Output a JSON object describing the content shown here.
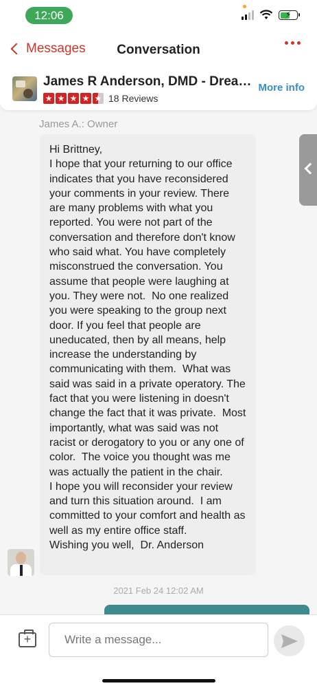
{
  "status_bar": {
    "time": "12:06",
    "signal_bars": 2,
    "battery_level": 0.6
  },
  "nav": {
    "back_label": "Messages",
    "title": "Conversation"
  },
  "business": {
    "name": "James R Anderson, DMD - Dreamw...",
    "rating": 4.5,
    "reviews_label": "18 Reviews",
    "more_info_label": "More info"
  },
  "conversation": {
    "sender_label": "James A.: Owner",
    "message": "Hi Brittney,\nI hope that your returning to our office indicates that you have reconsidered your comments in your review. There are many problems with what you reported. You were not part of the conversation and therefore don't know who said what. You have completely misconstrued the conversation. You assume that people were laughing at you. They were not.  No one realized you were speaking to the group next door. If you feel that people are uneducated, then by all means, help increase the understanding by communicating with them.  What was said was said in a private operatory. The fact that you were listening in doesn't change the fact that it was private.  Most importantly, what was said was not racist or derogatory to you or any one of color.  The voice you thought was me was actually the patient in the chair.\nI hope you will reconsider your review and turn this situation around.  I am committed to your comfort and health as well as my entire office staff.\nWishing you well,  Dr. Anderson",
    "timestamp": "2021 Feb 24 12:02 AM"
  },
  "composer": {
    "placeholder": "Write a message..."
  },
  "colors": {
    "accent": "#c9362b",
    "link": "#3a8fc4",
    "star": "#d32323",
    "outgoing_bubble": "#3d8b8e",
    "status_pill": "#3ea85a"
  }
}
